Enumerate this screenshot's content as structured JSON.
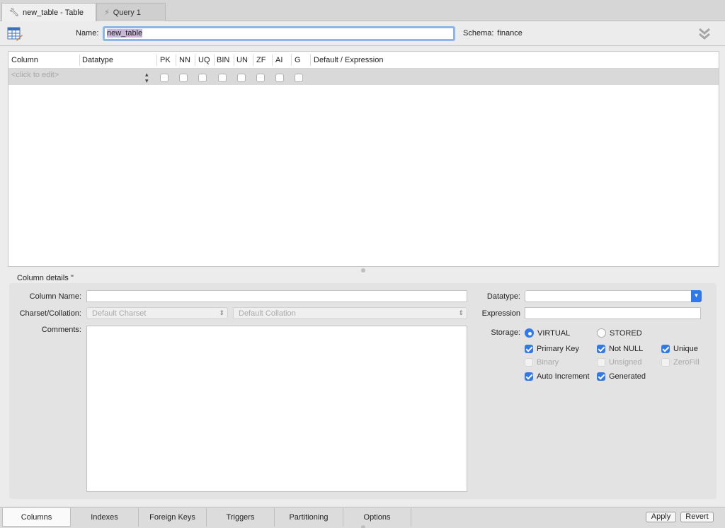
{
  "doc_tabs": [
    {
      "label": "new_table - Table",
      "icon": "wrench-icon"
    },
    {
      "label": "Query 1",
      "icon": "lightning-icon"
    }
  ],
  "header": {
    "name_label": "Name:",
    "name_value": "new_table",
    "schema_label": "Schema:",
    "schema_value": "finance"
  },
  "grid": {
    "columns": [
      "Column",
      "Datatype",
      "PK",
      "NN",
      "UQ",
      "BIN",
      "UN",
      "ZF",
      "AI",
      "G",
      "Default / Expression"
    ],
    "placeholder_row": "<click to edit>"
  },
  "details": {
    "title": "Column details ''",
    "column_name_label": "Column Name:",
    "charset_label": "Charset/Collation:",
    "charset_value": "Default Charset",
    "collation_value": "Default Collation",
    "comments_label": "Comments:",
    "datatype_label": "Datatype:",
    "expression_label": "Expression",
    "storage_label": "Storage:",
    "storage_virtual": "VIRTUAL",
    "storage_stored": "STORED",
    "flags": {
      "primary_key": "Primary Key",
      "not_null": "Not NULL",
      "unique": "Unique",
      "binary": "Binary",
      "unsigned": "Unsigned",
      "zerofill": "ZeroFill",
      "auto_increment": "Auto Increment",
      "generated": "Generated"
    }
  },
  "bottom_tabs": [
    "Columns",
    "Indexes",
    "Foreign Keys",
    "Triggers",
    "Partitioning",
    "Options"
  ],
  "buttons": {
    "apply": "Apply",
    "revert": "Revert"
  },
  "colors": {
    "accent": "#2f79e9",
    "focus_ring": "#8ab6e8",
    "selection": "#c9b6d9"
  }
}
